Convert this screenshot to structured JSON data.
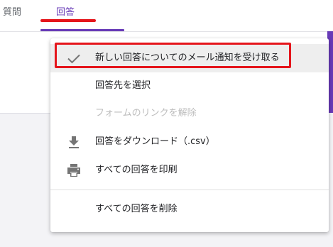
{
  "tabs": {
    "questions_label": "質問",
    "responses_label": "回答"
  },
  "menu": {
    "items": [
      {
        "label": "新しい回答についてのメール通知を受け取る",
        "icon": "check-icon"
      },
      {
        "label": "回答先を選択"
      },
      {
        "label": "フォームのリンクを解除"
      },
      {
        "label": "回答をダウンロード（.csv）",
        "icon": "download-icon"
      },
      {
        "label": "すべての回答を印刷",
        "icon": "print-icon"
      },
      {
        "label": "すべての回答を削除"
      }
    ]
  },
  "colors": {
    "accent": "#673ab7",
    "annotation": "#e5151b",
    "disabled_text": "#bdbdbd",
    "icon": "#757575"
  }
}
